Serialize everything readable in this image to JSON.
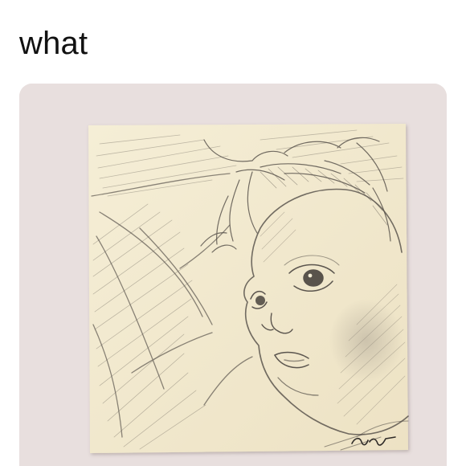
{
  "post": {
    "caption": "what"
  },
  "media": {
    "description_icon": "pencil-sketch-image",
    "background_color": "#e9e0df",
    "note_color": "#f3ead0",
    "pencil_color": "#5c5650"
  }
}
